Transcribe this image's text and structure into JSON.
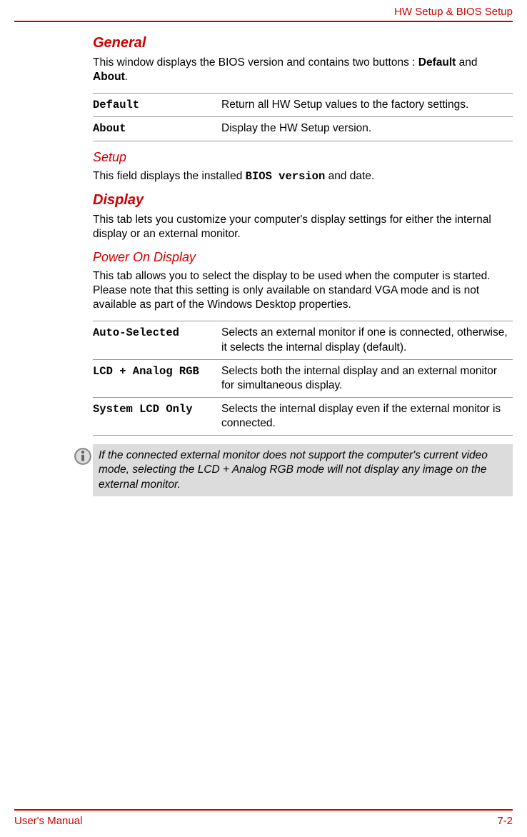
{
  "header": {
    "title": "HW Setup & BIOS Setup"
  },
  "sections": {
    "general": {
      "heading": "General",
      "intro_pre": "This window displays the BIOS version and contains two buttons : ",
      "intro_bold1": "Default",
      "intro_mid": " and ",
      "intro_bold2": "About",
      "intro_post": ".",
      "table": [
        {
          "term": "Default",
          "desc": "Return all HW Setup values to the factory settings."
        },
        {
          "term": "About",
          "desc": "Display the HW Setup version."
        }
      ]
    },
    "setup": {
      "heading": "Setup",
      "text_pre": "This field displays the installed ",
      "text_mono": "BIOS version",
      "text_post": " and date."
    },
    "display": {
      "heading": "Display",
      "text": "This tab lets you customize your computer's display settings for either the internal display or an external monitor."
    },
    "poweron": {
      "heading": "Power On Display",
      "text": "This tab allows you to select the display to be used when the computer is started. Please note that this setting is only available on standard VGA mode and is not available as part of the Windows Desktop properties.",
      "table": [
        {
          "term": "Auto-Selected",
          "desc": "Selects an external monitor if one is connected, otherwise, it selects the internal display (default)."
        },
        {
          "term": "LCD + Analog RGB",
          "desc": "Selects both the internal display and an external monitor for simultaneous display."
        },
        {
          "term": "System LCD Only",
          "desc": "Selects the internal display even if the external monitor is connected."
        }
      ]
    },
    "note": {
      "text": "If the connected external monitor does not support the computer's current video mode, selecting the LCD + Analog RGB mode will not display any image on the external monitor."
    }
  },
  "footer": {
    "left": "User's Manual",
    "right": "7-2"
  }
}
